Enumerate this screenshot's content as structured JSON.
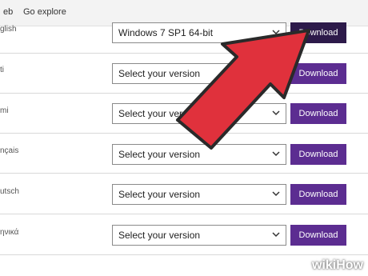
{
  "nav": {
    "partial_item": "eb",
    "explore": "Go explore"
  },
  "rows": [
    {
      "lang": "glish",
      "version": "Windows 7 SP1 64-bit",
      "button": "Download"
    },
    {
      "lang": "ti",
      "version": "Select your version",
      "button": "Download"
    },
    {
      "lang": "mi",
      "version": "Select your version",
      "button": "Download"
    },
    {
      "lang": "nçais",
      "version": "Select your version",
      "button": "Download"
    },
    {
      "lang": "utsch",
      "version": "Select your version",
      "button": "Download"
    },
    {
      "lang": "ηνικά",
      "version": "Select your version",
      "button": "Download"
    }
  ],
  "watermark": "wikiHow",
  "colors": {
    "button": "#5c2d91",
    "button_active": "#2d1a4a",
    "arrow": "#e0313c"
  },
  "icons": {
    "dropdown": "chevron-down-icon",
    "pointer": "red-arrow"
  }
}
